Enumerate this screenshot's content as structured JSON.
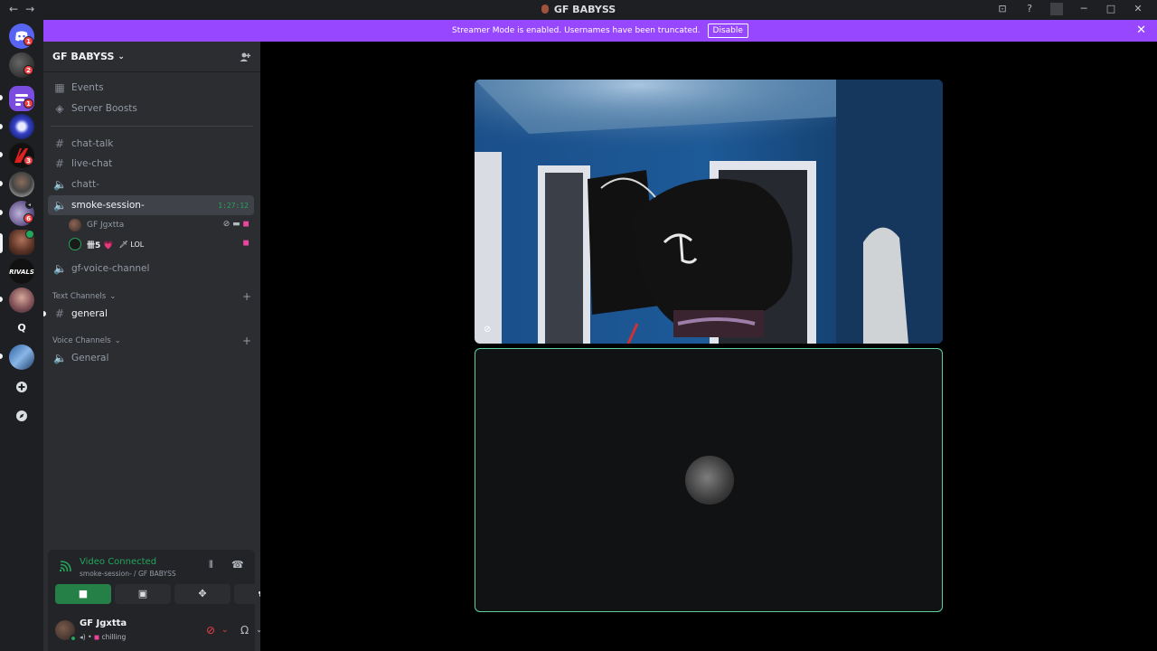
{
  "window": {
    "title": "GF BABYSS",
    "nav_back": "←",
    "nav_forward": "→",
    "controls": [
      "⊡",
      "?",
      "─",
      "□",
      "✕"
    ]
  },
  "banner": {
    "text": "Streamer Mode is enabled. Usernames have been truncated.",
    "button": "Disable",
    "close": "✕"
  },
  "guild_badges": [
    "1",
    "2",
    "1",
    "3",
    "6"
  ],
  "guild_letter": "Q",
  "server": {
    "name": "GF BABYSS",
    "chevron": "⌄",
    "invite_icon": "person-add"
  },
  "sidebar": {
    "events": "Events",
    "server_boosts": "Server Boosts",
    "channels": [
      {
        "name": "chat-talk",
        "type": "text"
      },
      {
        "name": "live-chat",
        "type": "text"
      },
      {
        "name": "chatt-",
        "type": "voice"
      },
      {
        "name": "smoke-session-",
        "type": "voice",
        "timer": "1:27:12",
        "active": true
      },
      {
        "name": "gf-voice-channel",
        "type": "voice"
      }
    ],
    "voice_users": [
      {
        "name": "GF Jgxtta"
      },
      {
        "name": "卌5 💗",
        "extra": "🗡 LOL"
      }
    ],
    "category_text": "Text Channels",
    "text_channel": "general",
    "category_voice": "Voice Channels",
    "voice_channel": "General"
  },
  "voice_panel": {
    "status": "Video Connected",
    "location": "smoke-session- / GF BABYSS"
  },
  "user": {
    "name": "GF Jgxtta",
    "status": "chilling"
  },
  "colors": {
    "banner": "#9747ff",
    "connected": "#23a55a",
    "speaking_border": "#5fd39a"
  }
}
